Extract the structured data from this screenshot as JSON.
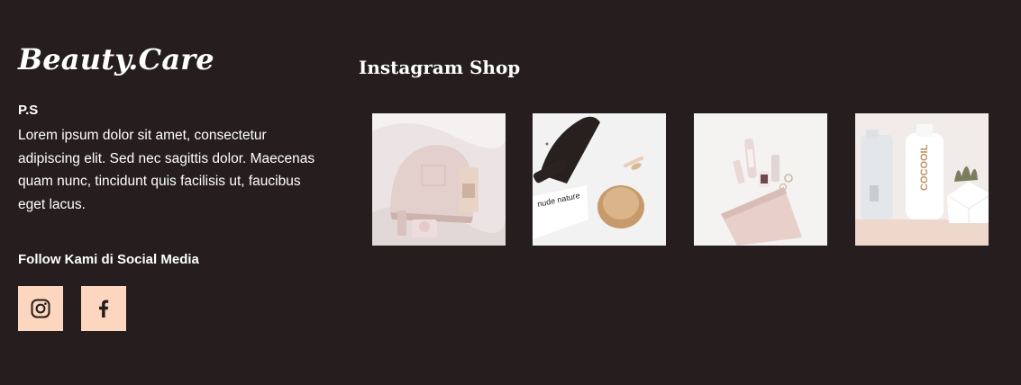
{
  "brand": {
    "name": "Beauty.Care"
  },
  "about": {
    "title": "P.S",
    "text": "Lorem ipsum dolor sit amet, consectetur adipiscing elit. Sed nec sagittis dolor. Maecenas quam nunc, tincidunt quis facilisis ut, faucibus eget lacus."
  },
  "social": {
    "heading": "Follow Kami di Social Media",
    "links": [
      {
        "icon": "instagram-icon"
      },
      {
        "icon": "facebook-icon"
      }
    ]
  },
  "instagram": {
    "title": "Instagram Shop",
    "photos": [
      {
        "icon": "makeup-pouch-photo"
      },
      {
        "icon": "brush-compact-photo",
        "caption": "nude nature"
      },
      {
        "icon": "pouch-perfume-photo"
      },
      {
        "icon": "cocooil-bottles-photo",
        "caption": "COCOOIL"
      }
    ]
  },
  "colors": {
    "background": "#251d1e",
    "text": "#ffffff",
    "accent": "#fcd6be"
  }
}
